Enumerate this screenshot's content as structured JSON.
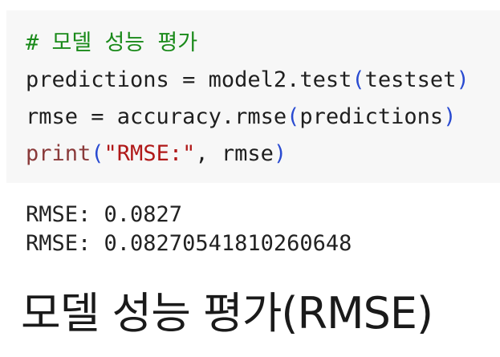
{
  "code": {
    "comment": "# 모델 성능 평가",
    "line2": {
      "text": "predictions = model2.test",
      "open_paren": "(",
      "arg": "testset",
      "close_paren": ")"
    },
    "line3": {
      "text": "rmse = accuracy.rmse",
      "open_paren": "(",
      "arg": "predictions",
      "close_paren": ")"
    },
    "line4": {
      "builtin": "print",
      "open_paren": "(",
      "string": "\"RMSE:\"",
      "rest": ", rmse",
      "close_paren": ")"
    }
  },
  "output": {
    "line1": "RMSE: 0.0827",
    "line2": "RMSE: 0.08270541810260648"
  },
  "heading": "모델 성능  평가(RMSE)",
  "colors": {
    "comment": "#1a8a1a",
    "builtin": "#8a3a3a",
    "paren": "#2a4bd1",
    "string": "#b01818",
    "cell_background": "#f7f7f7"
  }
}
